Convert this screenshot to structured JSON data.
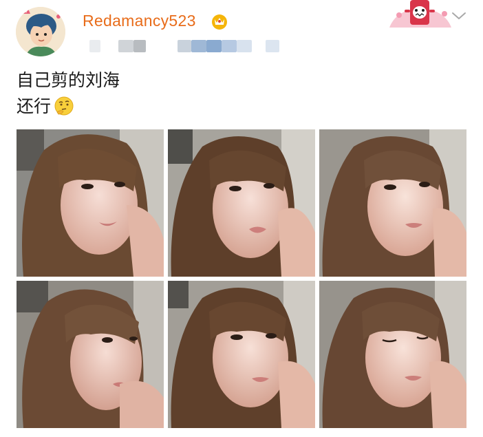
{
  "post": {
    "username": "Redamancy523",
    "text_line1": "自己剪的刘海",
    "text_line2": "还行",
    "emoji_icon": "thinking-face-icon",
    "photo_count": 6
  },
  "colors": {
    "username": "#e86c1a",
    "text": "#1a1a1a",
    "vip_badge": "#f5b50a"
  },
  "icons": {
    "avatar": "cartoon-avatar",
    "vip_badge": "vip-crown-icon",
    "sticker": "pink-monster-sticker",
    "chevron": "chevron-down-icon"
  }
}
